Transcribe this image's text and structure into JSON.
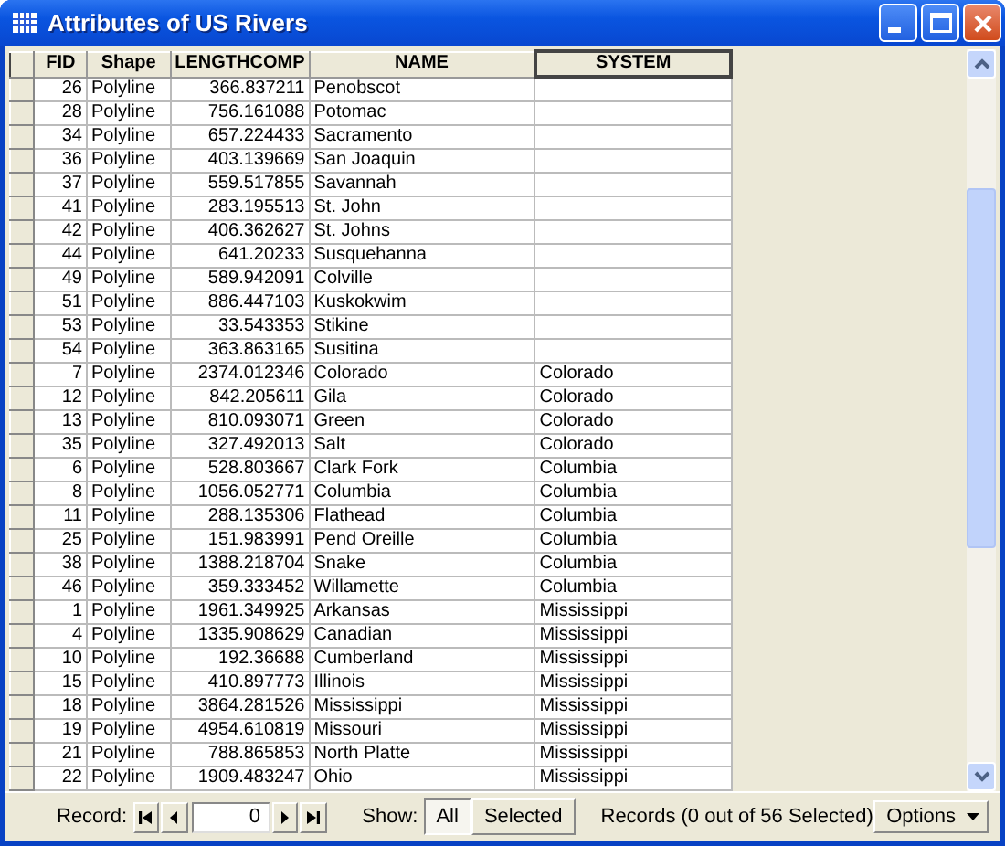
{
  "window": {
    "title": "Attributes of US Rivers"
  },
  "table": {
    "columns": [
      {
        "label": "FID",
        "selected": false
      },
      {
        "label": "Shape",
        "selected": false
      },
      {
        "label": "LENGTHCOMP",
        "selected": false
      },
      {
        "label": "NAME",
        "selected": false
      },
      {
        "label": "SYSTEM",
        "selected": true
      }
    ],
    "rows": [
      [
        "26",
        "Polyline",
        "366.837211",
        "Penobscot",
        ""
      ],
      [
        "28",
        "Polyline",
        "756.161088",
        "Potomac",
        ""
      ],
      [
        "34",
        "Polyline",
        "657.224433",
        "Sacramento",
        ""
      ],
      [
        "36",
        "Polyline",
        "403.139669",
        "San Joaquin",
        ""
      ],
      [
        "37",
        "Polyline",
        "559.517855",
        "Savannah",
        ""
      ],
      [
        "41",
        "Polyline",
        "283.195513",
        "St. John",
        ""
      ],
      [
        "42",
        "Polyline",
        "406.362627",
        "St. Johns",
        ""
      ],
      [
        "44",
        "Polyline",
        "641.20233",
        "Susquehanna",
        ""
      ],
      [
        "49",
        "Polyline",
        "589.942091",
        "Colville",
        ""
      ],
      [
        "51",
        "Polyline",
        "886.447103",
        "Kuskokwim",
        ""
      ],
      [
        "53",
        "Polyline",
        "33.543353",
        "Stikine",
        ""
      ],
      [
        "54",
        "Polyline",
        "363.863165",
        "Susitina",
        ""
      ],
      [
        "7",
        "Polyline",
        "2374.012346",
        "Colorado",
        "Colorado"
      ],
      [
        "12",
        "Polyline",
        "842.205611",
        "Gila",
        "Colorado"
      ],
      [
        "13",
        "Polyline",
        "810.093071",
        "Green",
        "Colorado"
      ],
      [
        "35",
        "Polyline",
        "327.492013",
        "Salt",
        "Colorado"
      ],
      [
        "6",
        "Polyline",
        "528.803667",
        "Clark Fork",
        "Columbia"
      ],
      [
        "8",
        "Polyline",
        "1056.052771",
        "Columbia",
        "Columbia"
      ],
      [
        "11",
        "Polyline",
        "288.135306",
        "Flathead",
        "Columbia"
      ],
      [
        "25",
        "Polyline",
        "151.983991",
        "Pend Oreille",
        "Columbia"
      ],
      [
        "38",
        "Polyline",
        "1388.218704",
        "Snake",
        "Columbia"
      ],
      [
        "46",
        "Polyline",
        "359.333452",
        "Willamette",
        "Columbia"
      ],
      [
        "1",
        "Polyline",
        "1961.349925",
        "Arkansas",
        "Mississippi"
      ],
      [
        "4",
        "Polyline",
        "1335.908629",
        "Canadian",
        "Mississippi"
      ],
      [
        "10",
        "Polyline",
        "192.36688",
        "Cumberland",
        "Mississippi"
      ],
      [
        "15",
        "Polyline",
        "410.897773",
        "Illinois",
        "Mississippi"
      ],
      [
        "18",
        "Polyline",
        "3864.281526",
        "Mississippi",
        "Mississippi"
      ],
      [
        "19",
        "Polyline",
        "4954.610819",
        "Missouri",
        "Mississippi"
      ],
      [
        "21",
        "Polyline",
        "788.865853",
        "North Platte",
        "Mississippi"
      ],
      [
        "22",
        "Polyline",
        "1909.483247",
        "Ohio",
        "Mississippi"
      ]
    ]
  },
  "status_bar": {
    "record_label": "Record:",
    "record_value": "0",
    "show_label": "Show:",
    "show_options": [
      {
        "label": "All",
        "selected": true
      },
      {
        "label": "Selected",
        "selected": false
      }
    ],
    "summary": "Records (0 out of 56 Selected)",
    "options_button": "Options"
  }
}
